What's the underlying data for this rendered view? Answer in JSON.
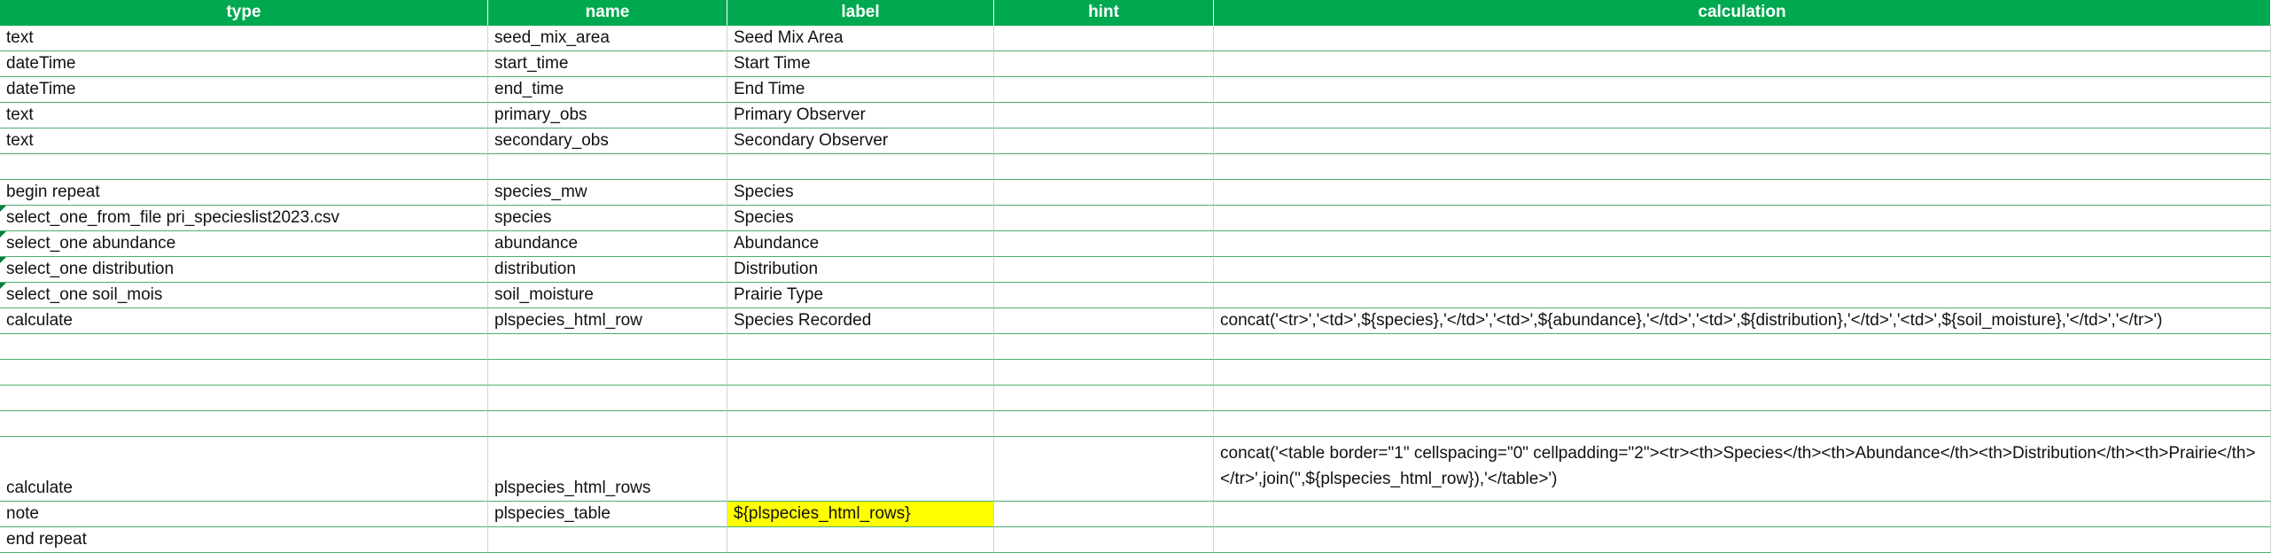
{
  "headers": {
    "type": "type",
    "name": "name",
    "label": "label",
    "hint": "hint",
    "calculation": "calculation"
  },
  "rows": [
    {
      "type": "text",
      "name": "seed_mix_area",
      "label": "Seed Mix Area",
      "hint": "",
      "calculation": ""
    },
    {
      "type": "dateTime",
      "name": "start_time",
      "label": "Start Time",
      "hint": "",
      "calculation": ""
    },
    {
      "type": "dateTime",
      "name": "end_time",
      "label": "End Time",
      "hint": "",
      "calculation": ""
    },
    {
      "type": "text",
      "name": "primary_obs",
      "label": "Primary Observer",
      "hint": "",
      "calculation": ""
    },
    {
      "type": "text",
      "name": "secondary_obs",
      "label": "Secondary Observer",
      "hint": "",
      "calculation": ""
    },
    {
      "type": "",
      "name": "",
      "label": "",
      "hint": "",
      "calculation": ""
    },
    {
      "type": "begin repeat",
      "name": "species_mw",
      "label": "Species",
      "hint": "",
      "calculation": ""
    },
    {
      "type": "select_one_from_file pri_specieslist2023.csv",
      "name": "species",
      "label": "Species",
      "hint": "",
      "calculation": ""
    },
    {
      "type": "select_one abundance",
      "name": "abundance",
      "label": "Abundance",
      "hint": "",
      "calculation": ""
    },
    {
      "type": "select_one distribution",
      "name": "distribution",
      "label": "Distribution",
      "hint": "",
      "calculation": ""
    },
    {
      "type": "select_one soil_mois",
      "name": "soil_moisture",
      "label": "Prairie Type",
      "hint": "",
      "calculation": ""
    },
    {
      "type": "calculate",
      "name": "plspecies_html_row",
      "label": "Species Recorded",
      "hint": "",
      "calculation": "concat('<tr>','<td>',${species},'</td>','<td>',${abundance},'</td>','<td>',${distribution},'</td>','<td>',${soil_moisture},'</td>','</tr>')"
    },
    {
      "type": "",
      "name": "",
      "label": "",
      "hint": "",
      "calculation": ""
    },
    {
      "type": "",
      "name": "",
      "label": "",
      "hint": "",
      "calculation": ""
    },
    {
      "type": "",
      "name": "",
      "label": "",
      "hint": "",
      "calculation": ""
    },
    {
      "type": "",
      "name": "",
      "label": "",
      "hint": "",
      "calculation": ""
    },
    {
      "type": "calculate",
      "name": "plspecies_html_rows",
      "label": "",
      "hint": "",
      "calculation": "concat('<table border=\"1\" cellspacing=\"0\" cellpadding=\"2\"><tr><th>Species</th><th>Abundance</th><th>Distribution</th><th>Prairie</th></tr>',join('',${plspecies_html_row}),'</table>')"
    },
    {
      "type": "note",
      "name": "plspecies_table",
      "label": "${plspecies_html_rows}",
      "hint": "",
      "calculation": ""
    },
    {
      "type": "end repeat",
      "name": "",
      "label": "",
      "hint": "",
      "calculation": ""
    }
  ],
  "colors": {
    "header_bg": "#00a84f",
    "row_line": "#4caf6e",
    "highlight": "#ffff00",
    "comment_flag": "#0a7d3e"
  }
}
